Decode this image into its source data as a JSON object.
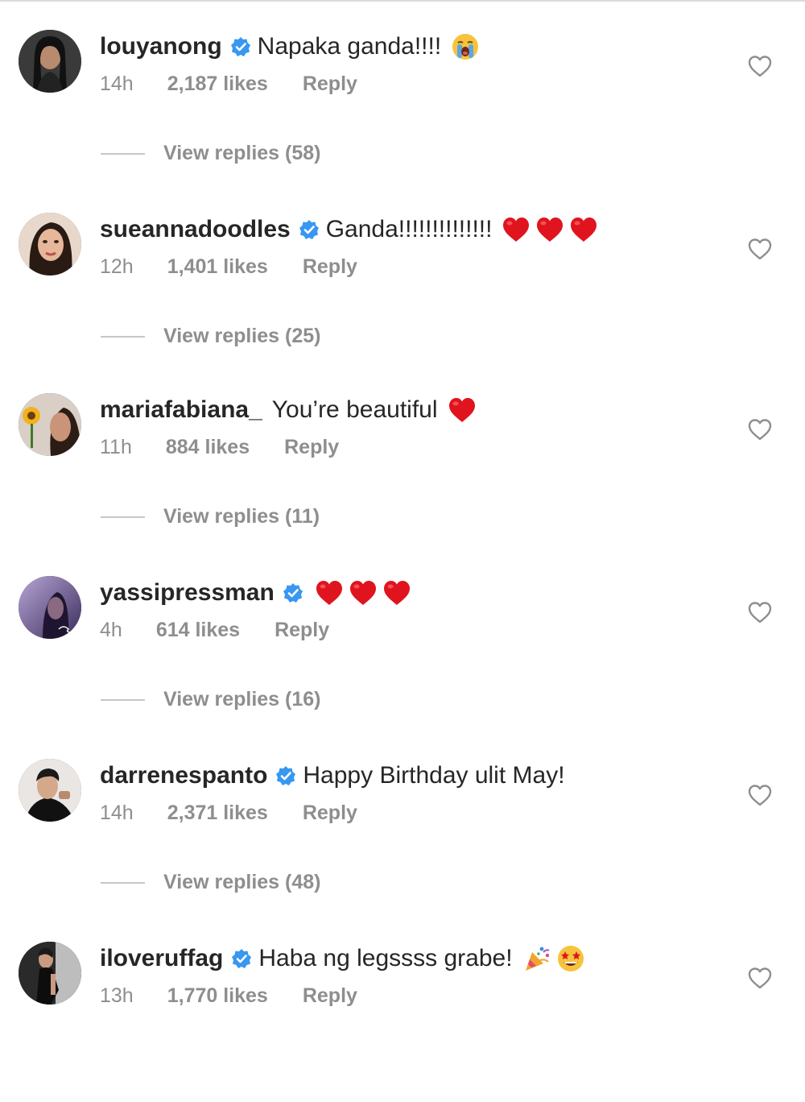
{
  "colors": {
    "primary_text": "#262626",
    "secondary_text": "#8e8e8e",
    "verified_blue": "#3897f0",
    "heart_red": "#e0141e"
  },
  "comments": [
    {
      "username": "louyanong",
      "verified": true,
      "text": "Napaka ganda!!!!",
      "emojis": [
        "loudly-crying-face"
      ],
      "time": "14h",
      "likes": "2,187 likes",
      "reply": "Reply",
      "view_replies": "View replies (58)"
    },
    {
      "username": "sueannadoodles",
      "verified": true,
      "text": "Ganda!!!!!!!!!!!!!!",
      "emojis": [
        "red-heart",
        "red-heart",
        "red-heart"
      ],
      "time": "12h",
      "likes": "1,401 likes",
      "reply": "Reply",
      "view_replies": "View replies (25)"
    },
    {
      "username": "mariafabiana_",
      "verified": false,
      "text": "You’re beautiful",
      "emojis": [
        "red-heart"
      ],
      "time": "11h",
      "likes": "884 likes",
      "reply": "Reply",
      "view_replies": "View replies (11)"
    },
    {
      "username": "yassipressman",
      "verified": true,
      "text": "",
      "emojis": [
        "red-heart",
        "red-heart",
        "red-heart"
      ],
      "time": "4h",
      "likes": "614 likes",
      "reply": "Reply",
      "view_replies": "View replies (16)"
    },
    {
      "username": "darrenespanto",
      "verified": true,
      "text": "Happy Birthday ulit May!",
      "emojis": [],
      "time": "14h",
      "likes": "2,371 likes",
      "reply": "Reply",
      "view_replies": "View replies (48)"
    },
    {
      "username": "iloveruffag",
      "verified": true,
      "text": "Haba ng legssss grabe!",
      "emojis": [
        "party-popper",
        "star-struck-face"
      ],
      "time": "13h",
      "likes": "1,770 likes",
      "reply": "Reply",
      "view_replies": ""
    }
  ]
}
